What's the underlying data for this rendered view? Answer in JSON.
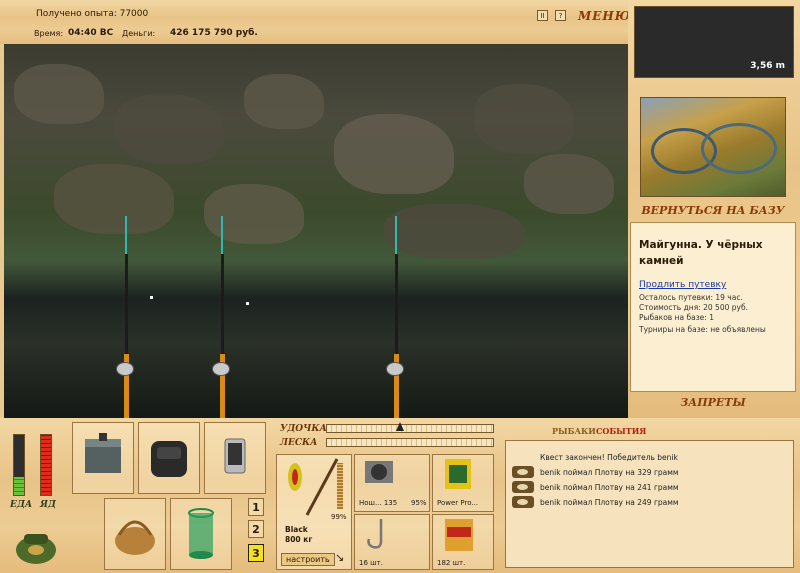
{
  "top": {
    "experience": "Получено опыта: 77000",
    "time_label": "Время:",
    "time_value": "04:40 ВС",
    "money_label": "Деньги:",
    "money_value": "426 175 790 руб.",
    "pause_icon": "II",
    "help_icon": "?",
    "menu_label": "МЕНЮ"
  },
  "right": {
    "depth": "3,56 m",
    "return_label": "ВЕРНУТЬСЯ НА БАЗУ",
    "location_title": "Майгунна. У чёрных камней",
    "extend_link": "Продлить путевку",
    "remaining": "Осталось путевки: 19 час.",
    "cost": "Стоимость дня: 20 500 руб.",
    "anglers": "Рыбаков на базе: 1",
    "tournaments": "Турниры на базе: не объявлены",
    "restrictions_label": "ЗАПРЕТЫ"
  },
  "bottom": {
    "food_label": "ЕДА",
    "alcohol_label": "ЯД",
    "food_level": 0.3,
    "alcohol_level": 1.0,
    "slot_numbers": [
      "1",
      "2",
      "3"
    ],
    "active_slot": "3",
    "rod_label": "УДОЧКА",
    "line_label": "ЛЕСКА",
    "rod_name": "Black",
    "rod_weight": "800 кг",
    "rod_percent": "99%",
    "reel_name": "Нош... 135",
    "reel_percent": "95%",
    "line_name": "Power Pro...",
    "hook_count": "16 шт.",
    "bait_count": "182 шт.",
    "configure_btn": "настроить"
  },
  "log": {
    "tab_anglers": "РЫБАКИ",
    "tab_events": "СОБЫТИЯ",
    "quest_line": "Квест закончен! Победитель benik",
    "entries": [
      "benik поймал Плотву на 329 грамм",
      "benik поймал Плотву на 241 грамм",
      "benik поймал Плотву на 249 грамм"
    ]
  },
  "colors": {
    "accent": "#8a3a08",
    "active_slot": "#f6e21a",
    "link": "#1a3aa8"
  }
}
